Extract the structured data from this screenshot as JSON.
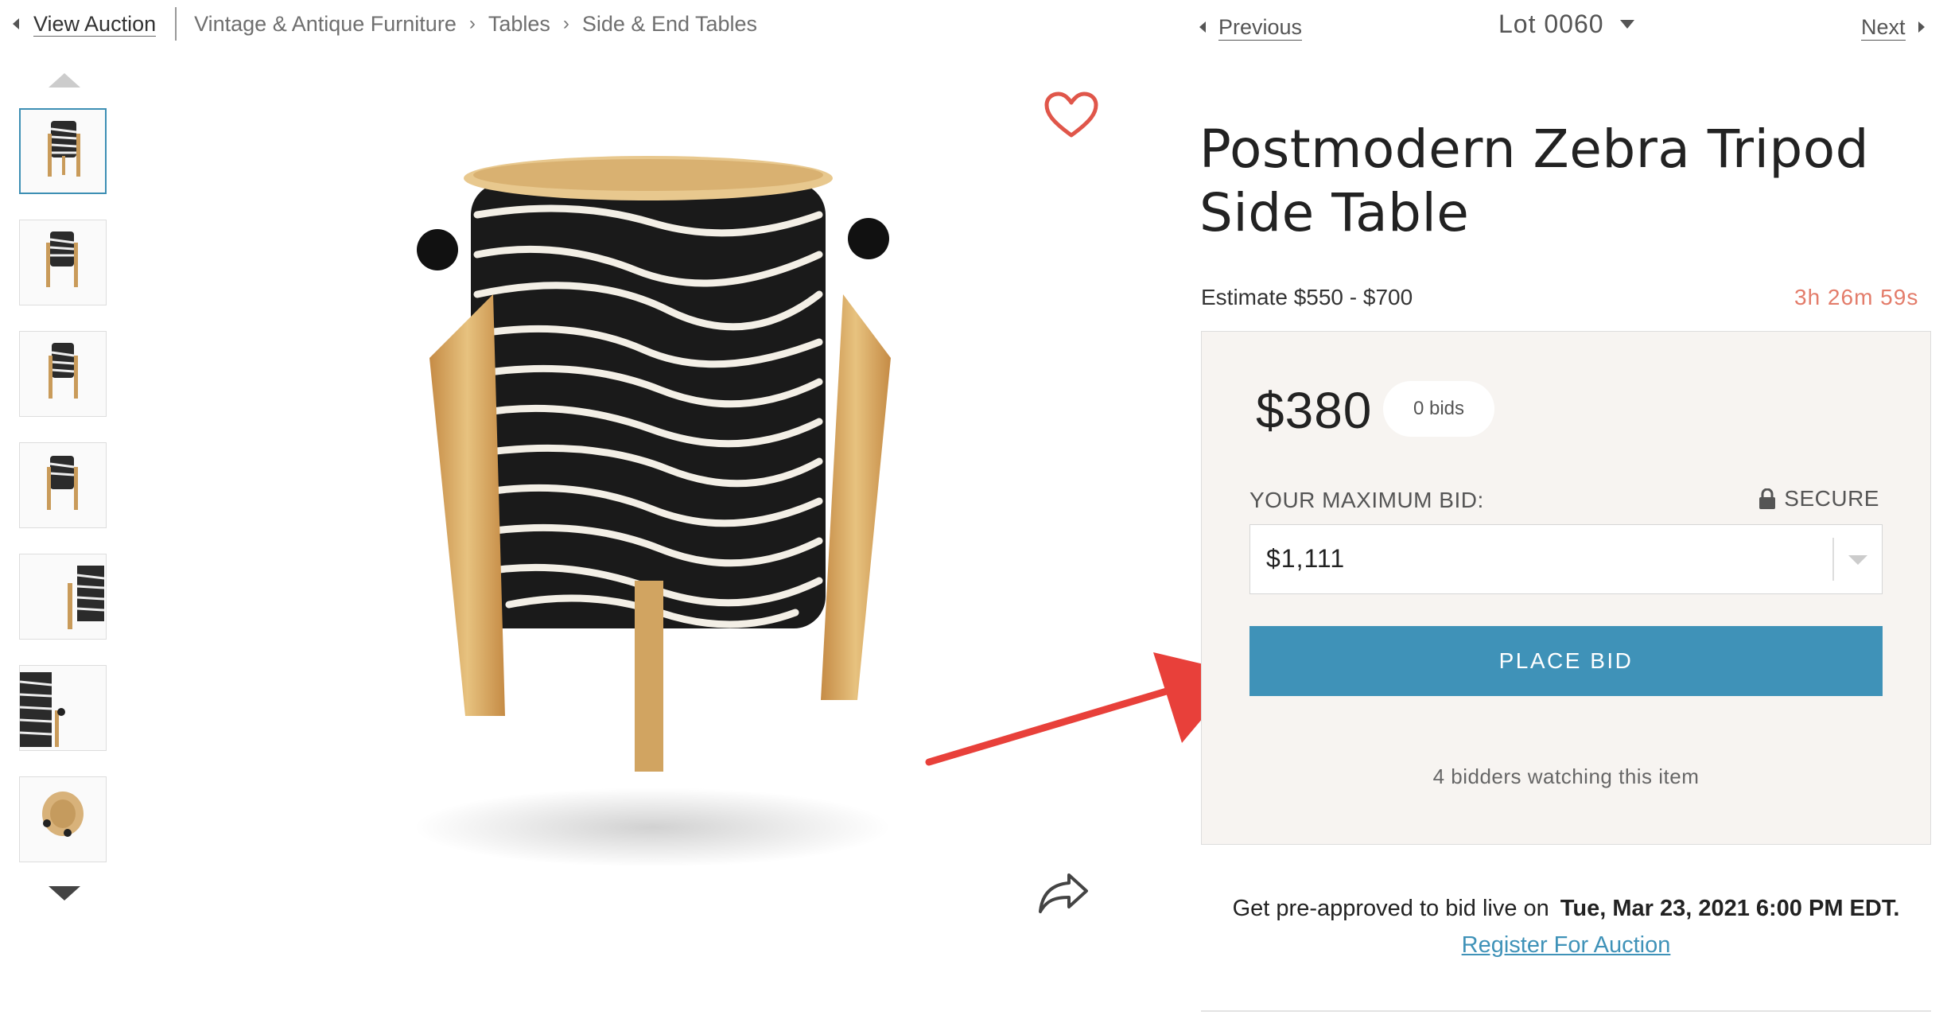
{
  "breadcrumb": {
    "back_label": "View Auction",
    "items": [
      "Vintage & Antique Furniture",
      "Tables",
      "Side & End Tables"
    ]
  },
  "lot_nav": {
    "previous_label": "Previous",
    "lot_label": "Lot 0060",
    "next_label": "Next"
  },
  "product": {
    "title": "Postmodern Zebra Tripod Side Table",
    "estimate": "Estimate $550 - $700",
    "time_left": "3h 26m 59s"
  },
  "bid_panel": {
    "current_price": "$380",
    "bid_count": "0 bids",
    "max_bid_label": "YOUR MAXIMUM BID:",
    "secure_label": "SECURE",
    "max_bid_value": "$1,111",
    "place_bid_label": "PLACE BID",
    "watchers_text": "4 bidders watching this item"
  },
  "preapproval": {
    "text": "Get pre-approved to bid live on",
    "date": "Tue, Mar 23, 2021 6:00 PM EDT.",
    "register_label": "Register For Auction"
  },
  "colors": {
    "accent": "#3f92b8",
    "timer": "#e37c6a",
    "heart": "#e0564a",
    "annotation_arrow": "#e8403a",
    "panel_bg": "#f7f4f1"
  },
  "icons": {
    "favorite": "heart-icon",
    "share": "share-icon",
    "secure": "lock-icon",
    "dropdown": "caret-down-icon",
    "gallery_up": "arrow-up-icon",
    "gallery_down": "arrow-down-icon"
  }
}
